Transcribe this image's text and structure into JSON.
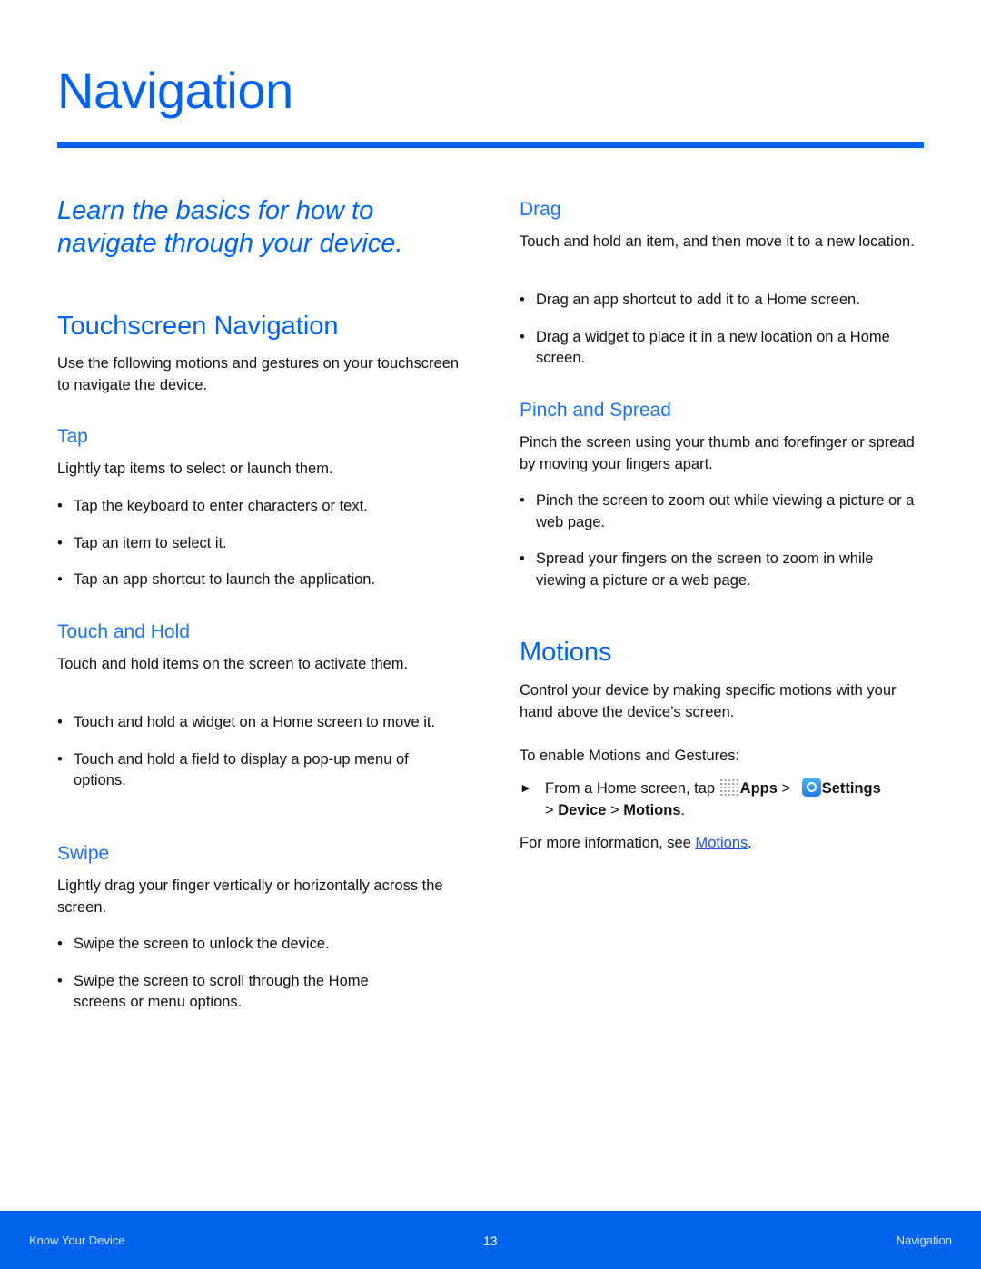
{
  "page": {
    "title": "Navigation",
    "intro": "Learn the basics for how to navigate through your device.",
    "accent_color": "#0063ee"
  },
  "touchscreen": {
    "heading": "Touchscreen Navigation",
    "body": "Use the following motions and gestures on your touchscreen to navigate the device.",
    "tap": {
      "heading": "Tap",
      "body": "Lightly tap items to select or launch them.",
      "bullets": [
        "Tap the keyboard to enter characters or text.",
        "Tap an item to select it.",
        "Tap an app shortcut to launch the application."
      ]
    },
    "touch_hold": {
      "heading": "Touch and Hold",
      "body": "Touch and hold items on the screen to activate them.",
      "bullets": [
        "Touch and hold a widget on a Home screen to move it.",
        "Touch and hold a field to display a pop-up menu of options."
      ]
    },
    "swipe": {
      "heading": "Swipe",
      "body": "Lightly drag your finger vertically or horizontally across the screen.",
      "bullets": [
        "Swipe the screen to unlock the device.",
        "Swipe the screen to scroll through the Home screens or menu options."
      ]
    },
    "drag": {
      "heading": "Drag",
      "body": "Touch and hold an item, and then move it to a new location.",
      "bullets": [
        "Drag an app shortcut to add it to a Home screen.",
        "Drag a widget to place it in a new location on a Home screen."
      ]
    },
    "pinch": {
      "heading": "Pinch and Spread",
      "body": "Pinch the screen using your thumb and forefinger or spread by moving your fingers apart.",
      "bullets": [
        "Pinch the screen to zoom out while viewing a picture or a web page.",
        "Spread your fingers on the screen to zoom in while viewing a picture or a web page."
      ]
    }
  },
  "motions": {
    "heading": "Motions",
    "body": "Control your device by making specific motions with your hand above the device’s screen.",
    "enable_label": "To enable Motions and Gestures:",
    "step": {
      "arrow": "►",
      "prefix": "From a Home screen, tap ",
      "apps": "Apps",
      "sep1": " > ",
      "settings": "Settings",
      "sep2": " > ",
      "device": "Device",
      "sep3": " > ",
      "motions": "Motions",
      "suffix": "."
    },
    "more_prefix": "For more information, see ",
    "more_link": "Motions",
    "more_suffix": "."
  },
  "footer": {
    "left": "Know Your Device",
    "page_number": "13",
    "right": "Navigation"
  }
}
